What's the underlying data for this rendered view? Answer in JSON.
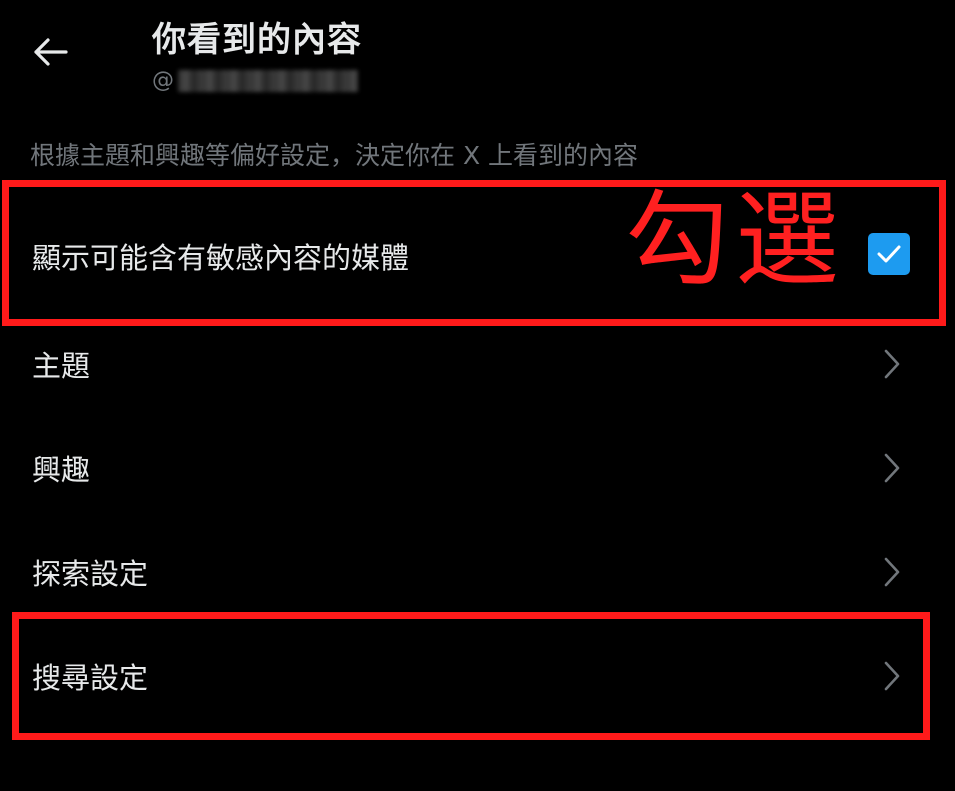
{
  "header": {
    "title": "你看到的內容",
    "handle_prefix": "@"
  },
  "description": "根據主題和興趣等偏好設定，決定你在 X 上看到的內容",
  "sensitive_media": {
    "label": "顯示可能含有敏感內容的媒體",
    "checked": true,
    "checkbox_color": "#1d9bf0"
  },
  "menu": {
    "topics": "主題",
    "interests": "興趣",
    "explore": "探索設定",
    "search": "搜尋設定"
  },
  "annotation": {
    "text": "勾選",
    "color": "#ff1a1a"
  },
  "icons": {
    "back": "arrow-left-icon",
    "chevron": "chevron-right-icon",
    "check": "checkmark-icon"
  }
}
